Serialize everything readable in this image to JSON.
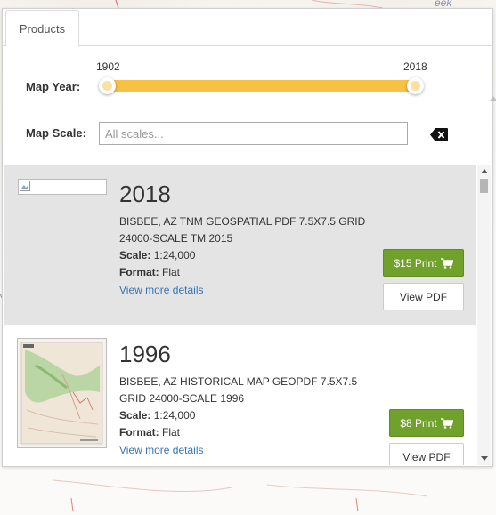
{
  "panel": {
    "tab_label": "Products"
  },
  "filters": {
    "year_label": "Map Year:",
    "year_min": "1902",
    "year_max": "2018",
    "scale_label": "Map Scale:",
    "scale_placeholder": "All scales...",
    "scale_value": ""
  },
  "products": [
    {
      "year": "2018",
      "title": "BISBEE, AZ TNM GEOSPATIAL PDF 7.5X7.5 GRID 24000-SCALE TM 2015",
      "scale_label": "Scale:",
      "scale_value": "1:24,000",
      "format_label": "Format:",
      "format_value": "Flat",
      "details_link": "View more details",
      "print_label": "$15 Print",
      "pdf_label": "View PDF",
      "thumbnail": "broken-image-icon",
      "selected": true
    },
    {
      "year": "1996",
      "title": "BISBEE, AZ HISTORICAL MAP GEOPDF 7.5X7.5 GRID 24000-SCALE 1996",
      "scale_label": "Scale:",
      "scale_value": "1:24,000",
      "format_label": "Format:",
      "format_value": "Flat",
      "details_link": "View more details",
      "print_label": "$8 Print",
      "pdf_label": "View PDF",
      "thumbnail": "topo-map-thumbnail",
      "selected": false
    }
  ],
  "map": {
    "corner_text": "eek"
  },
  "colors": {
    "slider": "#f7c143",
    "print_button": "#6fa12b",
    "link": "#3574b8",
    "selected_row": "#e4e4e4"
  }
}
